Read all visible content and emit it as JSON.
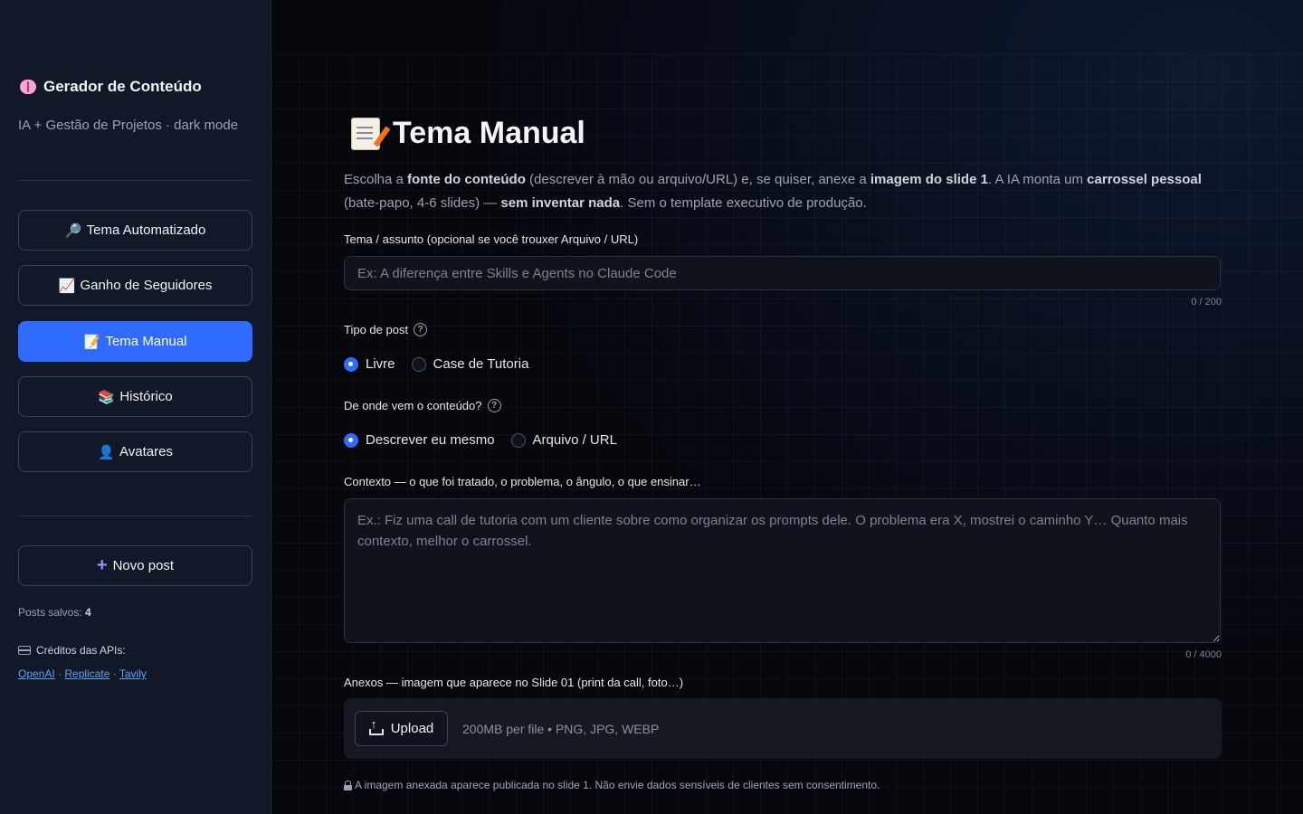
{
  "sidebar": {
    "brand_title": "Gerador de Conteúdo",
    "brand_icon": "brain-icon",
    "subtitle": "IA + Gestão de Projetos · dark mode",
    "nav": [
      {
        "label": "Tema Automatizado",
        "icon": "🔎",
        "active": false
      },
      {
        "label": "Ganho de Seguidores",
        "icon": "📈",
        "active": false
      },
      {
        "label": "Tema Manual",
        "icon": "📝",
        "active": true
      },
      {
        "label": "Histórico",
        "icon": "📚",
        "active": false
      },
      {
        "label": "Avatares",
        "icon": "👤",
        "active": false
      }
    ],
    "new_post_label": "Novo post",
    "posts_saved_label": "Posts salvos:",
    "posts_saved_count": "4",
    "credits_label": "Créditos das APIs:",
    "api_links": [
      "OpenAI",
      "Replicate",
      "Tavily"
    ],
    "accent_color": "#2f6bff"
  },
  "main": {
    "title": "Tema Manual",
    "intro": {
      "p1": "Escolha a ",
      "b1": "fonte do conteúdo",
      "p2": " (descrever à mão ou arquivo/URL) e, se quiser, anexe a ",
      "b2": "imagem do slide 1",
      "p3": ". A IA monta um ",
      "b3": "carrossel pessoal",
      "p4": " (bate-papo, 4-6 slides) — ",
      "b4": "sem inventar nada",
      "p5": ". Sem o template executivo de produção."
    },
    "topic": {
      "label": "Tema / assunto (opcional se você trouxer Arquivo / URL)",
      "placeholder": "Ex: A diferença entre Skills e Agents no Claude Code",
      "value": "",
      "counter": "0 / 200"
    },
    "post_type": {
      "label": "Tipo de post",
      "options": [
        "Livre",
        "Case de Tutoria"
      ],
      "selected": "Livre"
    },
    "source": {
      "label": "De onde vem o conteúdo?",
      "options": [
        "Descrever eu mesmo",
        "Arquivo / URL"
      ],
      "selected": "Descrever eu mesmo"
    },
    "context": {
      "label": "Contexto — o que foi tratado, o problema, o ângulo, o que ensinar…",
      "placeholder": "Ex.: Fiz uma call de tutoria com um cliente sobre como organizar os prompts dele. O problema era X, mostrei o caminho Y… Quanto mais contexto, melhor o carrossel.",
      "value": "",
      "counter": "0 / 4000"
    },
    "attachments": {
      "label": "Anexos — imagem que aparece no Slide 01 (print da call, foto…)",
      "upload_label": "Upload",
      "hint": "200MB per file • PNG, JPG, WEBP"
    },
    "footnote": "A imagem anexada aparece publicada no slide 1. Não envie dados sensíveis de clientes sem consentimento."
  }
}
